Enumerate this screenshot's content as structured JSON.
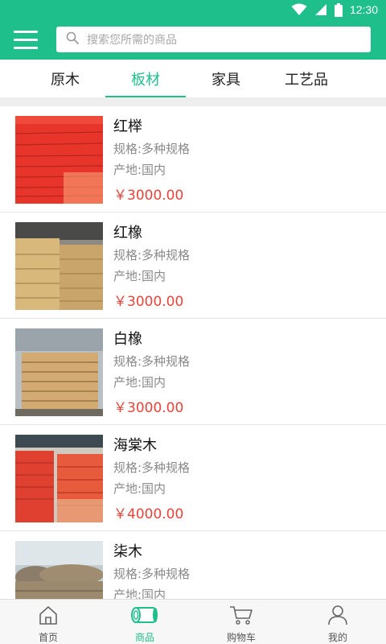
{
  "status_bar": {
    "time": "12:30",
    "icons": [
      "wifi-icon",
      "signal-icon",
      "battery-icon"
    ]
  },
  "header": {
    "menu_icon": "hamburger-icon",
    "search": {
      "icon": "search-icon",
      "placeholder": "搜索您所需的商品"
    }
  },
  "tabs": [
    {
      "label": "原木",
      "active": false
    },
    {
      "label": "板材",
      "active": true
    },
    {
      "label": "家具",
      "active": false
    },
    {
      "label": "工艺品",
      "active": false
    }
  ],
  "products": [
    {
      "name": "红榉",
      "spec": "规格:多种规格",
      "origin": "产地:国内",
      "price": "￥3000.00"
    },
    {
      "name": "红橡",
      "spec": "规格:多种规格",
      "origin": "产地:国内",
      "price": "￥3000.00"
    },
    {
      "name": "白橡",
      "spec": "规格:多种规格",
      "origin": "产地:国内",
      "price": "￥3000.00"
    },
    {
      "name": "海棠木",
      "spec": "规格:多种规格",
      "origin": "产地:国内",
      "price": "￥4000.00"
    },
    {
      "name": "柒木",
      "spec": "规格:多种规格",
      "origin": "产地:国内",
      "price": ""
    }
  ],
  "bottom_nav": [
    {
      "label": "首页",
      "icon": "home-icon",
      "active": false
    },
    {
      "label": "商品",
      "icon": "wood-log-icon",
      "active": true
    },
    {
      "label": "购物车",
      "icon": "cart-icon",
      "active": false
    },
    {
      "label": "我的",
      "icon": "user-icon",
      "active": false
    }
  ],
  "colors": {
    "primary": "#1ebf8a",
    "price": "#e8443a",
    "text_secondary": "#8a8a8a"
  }
}
